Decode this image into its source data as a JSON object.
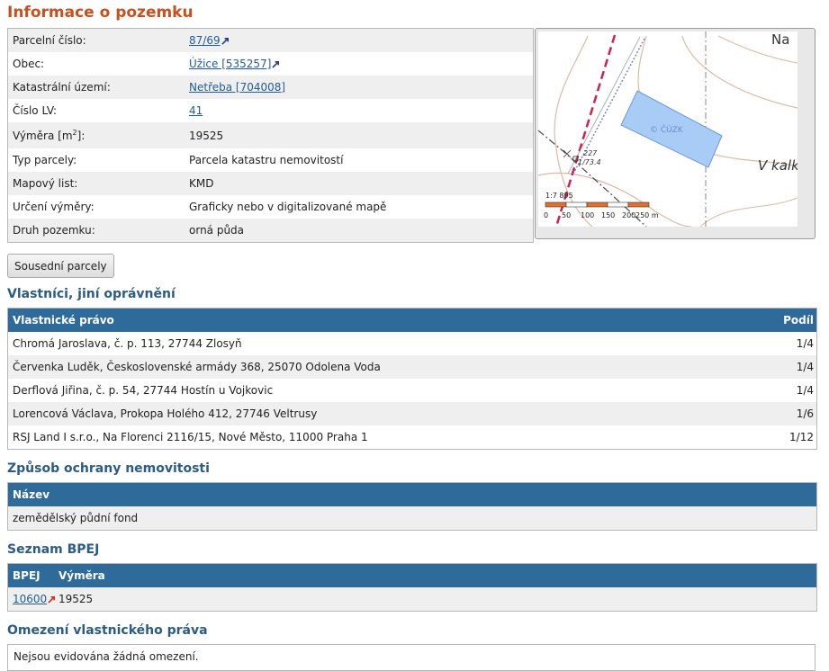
{
  "page_title": "Informace o pozemku",
  "info": {
    "rows": [
      {
        "label": "Parcelní číslo:",
        "value": "87/69",
        "link": true
      },
      {
        "label": "Obec:",
        "value": "Úžice [535257]",
        "link": true
      },
      {
        "label": "Katastrální území:",
        "value": "Netřeba [704008]",
        "link": true
      },
      {
        "label": "Číslo LV:",
        "value": "41",
        "link": true
      },
      {
        "label_pre": "Výměra [m",
        "label_sup": "2",
        "label_post": "]:",
        "value": "19525"
      },
      {
        "label": "Typ parcely:",
        "value": "Parcela katastru nemovitostí"
      },
      {
        "label": "Mapový list:",
        "value": "KMD"
      },
      {
        "label": "Určení výměry:",
        "value": "Graficky nebo v digitalizované mapě"
      },
      {
        "label": "Druh pozemku:",
        "value": "orná půda"
      }
    ]
  },
  "map": {
    "label_na": "Na",
    "label_v_kalk": "V kalk",
    "label_cuzk": "© ČÚZK",
    "label_227": "227",
    "label_1734": "1/73.4",
    "scale_ratio": "1:7 895",
    "scale_ticks": [
      "0",
      "50",
      "100",
      "150",
      "200",
      "250 m"
    ]
  },
  "neighbors_button": "Sousední parcely",
  "owners": {
    "heading": "Vlastníci, jiní oprávnění",
    "col_name": "Vlastnické právo",
    "col_share": "Podíl",
    "rows": [
      {
        "name": "Chromá Jaroslava, č. p. 113, 27744 Zlosyň",
        "share": "1/4"
      },
      {
        "name": "Červenka Luděk, Československé armády 368, 25070 Odolena Voda",
        "share": "1/4"
      },
      {
        "name": "Derflová Jiřina, č. p. 54, 27744 Hostín u Vojkovic",
        "share": "1/4"
      },
      {
        "name": "Lorencová Václava, Prokopa Holého 412, 27746 Veltrusy",
        "share": "1/6"
      },
      {
        "name": "RSJ Land I s.r.o., Na Florenci 2116/15, Nové Město, 11000 Praha 1",
        "share": "1/12"
      }
    ]
  },
  "protection": {
    "heading": "Způsob ochrany nemovitosti",
    "col_name": "Název",
    "rows": [
      {
        "name": "zemědělský půdní fond"
      }
    ]
  },
  "bpej": {
    "heading": "Seznam BPEJ",
    "col_bpej": "BPEJ",
    "col_area": "Výměra",
    "rows": [
      {
        "code": "10600",
        "area": "19525"
      }
    ]
  },
  "restrictions": {
    "heading": "Omezení vlastnického práva",
    "text": "Nejsou evidována žádná omezení."
  },
  "colors": {
    "title": "#c8501e",
    "heading": "#2b5b87",
    "table_header": "#2e6a9a",
    "link": "#1f5e97"
  }
}
